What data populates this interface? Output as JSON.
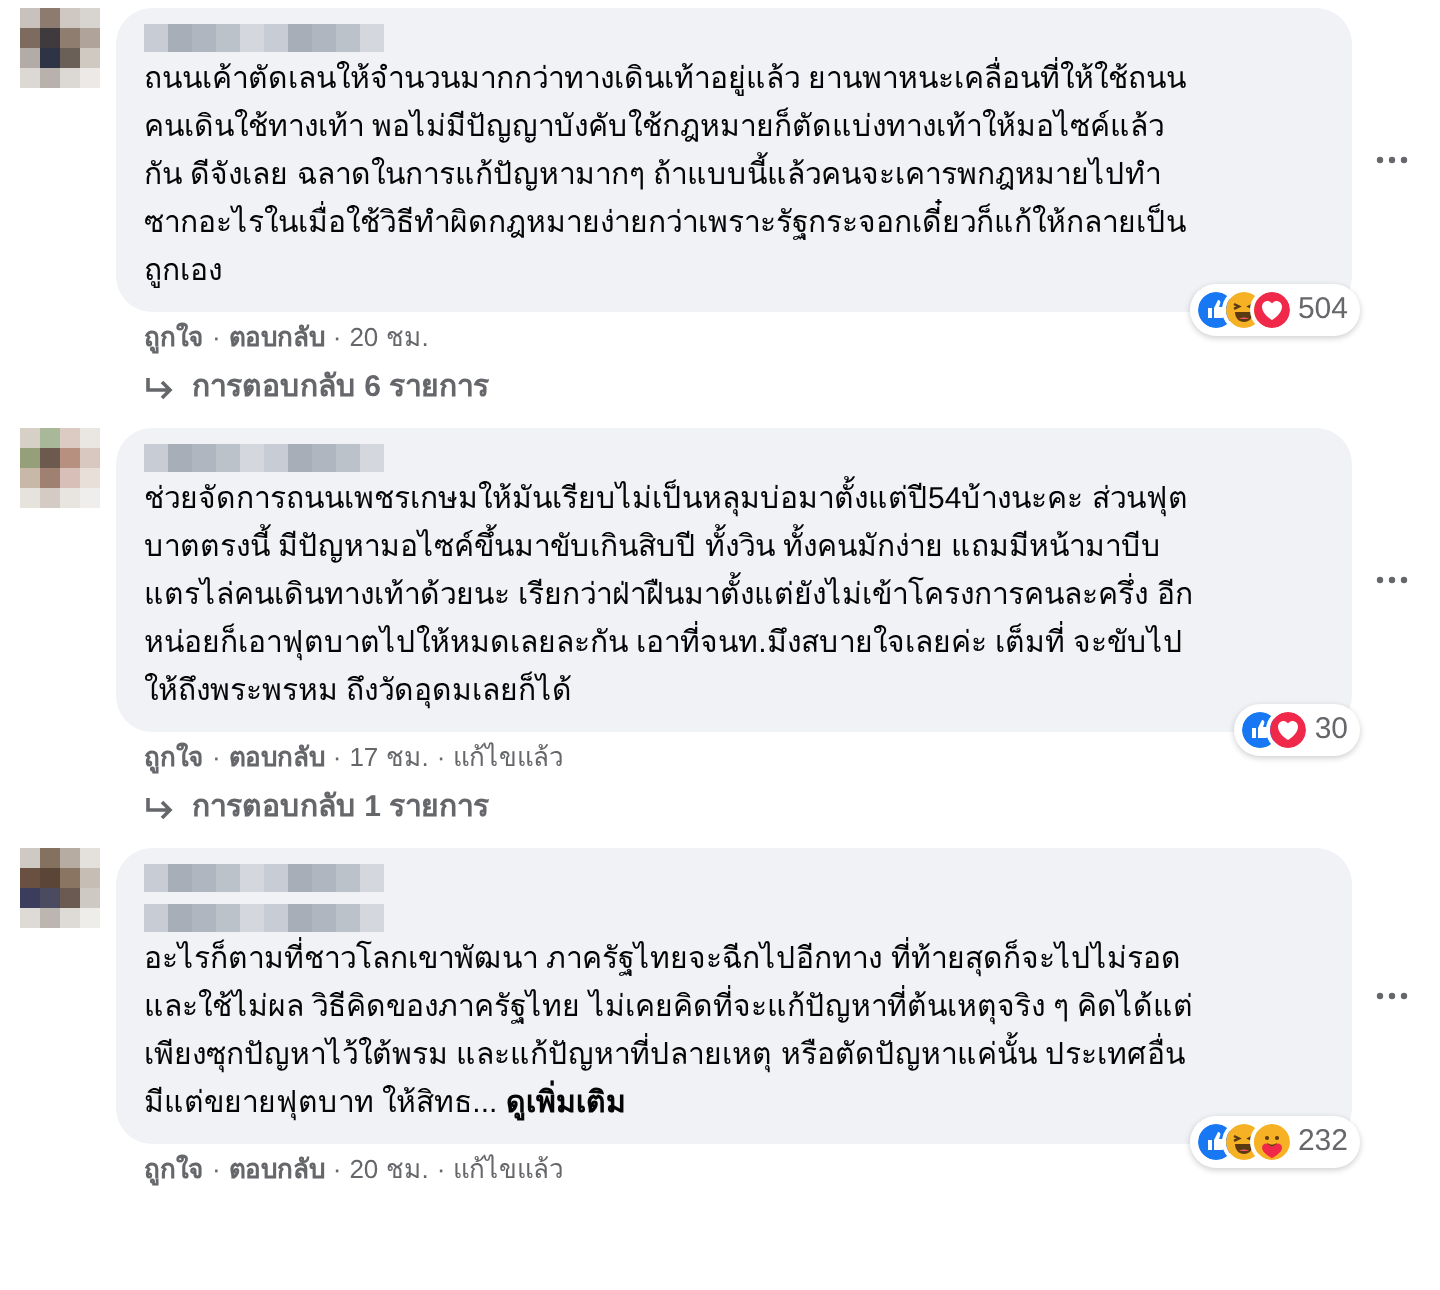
{
  "comments": [
    {
      "name": [
        {
          "kind": "picture"
        }
      ],
      "text": "ถนนเค้าตัดเลนให้จำนวนมากกว่าทางเดินเท้าอยู่แล้ว ยานพาหนะเคลื่อนที่ให้ใช้ถนน\nคนเดินใช้ทางเท้า พอไม่มีปัญญาบังคับใช้กฎหมายก็ตัดแบ่งทางเท้าให้มอไซค์แล้ว\nกัน ดีจังเลย ฉลาดในการแก้ปัญหามากๆ ถ้าแบบนี้แล้วคนจะเคารพกฎหมายไปทำ\nซากอะไรในเมื่อใช้วิธีทำผิดกฎหมายง่ายกว่าเพราะรัฐกระจอกเดี๋ยวก็แก้ให้กลายเป็น\nถูกเอง",
      "reactions": [
        {
          "kind": "like"
        },
        {
          "kind": "haha"
        },
        {
          "kind": "love"
        }
      ],
      "reaction_count": "504",
      "actions": [
        "ถูกใจ",
        "ตอบกลับ",
        "20 ชม."
      ],
      "separators": [
        "·",
        "·"
      ],
      "replies": "การตอบกลับ 6 รายการ"
    },
    {
      "name": [
        {
          "kind": "picture"
        }
      ],
      "text": "ช่วยจัดการถนนเพชรเกษมให้มันเรียบไม่เป็นหลุมบ่อมาตั้งแต่ปี54บ้างนะคะ ส่วนฟุต\nบาตตรงนี้ มีปัญหามอไซค์ขึ้นมาขับเกินสิบปี ทั้งวิน ทั้งคนมักง่าย แถมมีหน้ามาบีบ\nแตรไล่คนเดินทางเท้าด้วยนะ เรียกว่าฝ่าฝืนมาตั้งแต่ยังไม่เข้าโครงการคนละครึ่ง อีก\nหน่อยก็เอาฟุตบาตไปให้หมดเลยละกัน เอาที่จนท.มึงสบายใจเลยค่ะ เต็มที่ จะขับไป\nให้ถึงพระพรหม ถึงวัดอุดมเลยก็ได้",
      "reactions": [
        {
          "kind": "like"
        },
        {
          "kind": "love"
        }
      ],
      "reaction_count": "30",
      "actions": [
        "ถูกใจ",
        "ตอบกลับ",
        "17 ชม.",
        "แก้ไขแล้ว"
      ],
      "separators": [
        "·",
        "·",
        "·"
      ],
      "replies": "การตอบกลับ 1 รายการ"
    },
    {
      "name": [
        {
          "kind": "picture"
        },
        {
          "kind": "picture"
        }
      ],
      "text": "อะไรก็ตามที่ชาวโลกเขาพัฒนา ภาครัฐไทยจะฉีกไปอีกทาง ที่ท้ายสุดก็จะไปไม่รอด\nและใช้ไม่ผล วิธีคิดของภาครัฐไทย ไม่เคยคิดที่จะแก้ปัญหาที่ต้นเหตุจริง ๆ คิดได้แต่\nเพียงซุกปัญหาไว้ใต้พรม และแก้ปัญหาที่ปลายเหตุ หรือตัดปัญหาแค่นั้น ประเทศอื่น\nมีแต่ขยายฟุตบาท ให้สิทธ...",
      "see_more": "ดูเพิ่มเติม",
      "reactions": [
        {
          "kind": "like"
        },
        {
          "kind": "haha"
        },
        {
          "kind": "care"
        }
      ],
      "reaction_count": "232",
      "actions": [
        "ถูกใจ",
        "ตอบกลับ",
        "20 ชม.",
        "แก้ไขแล้ว"
      ],
      "separators": [
        "·",
        "·",
        "·"
      ]
    }
  ]
}
